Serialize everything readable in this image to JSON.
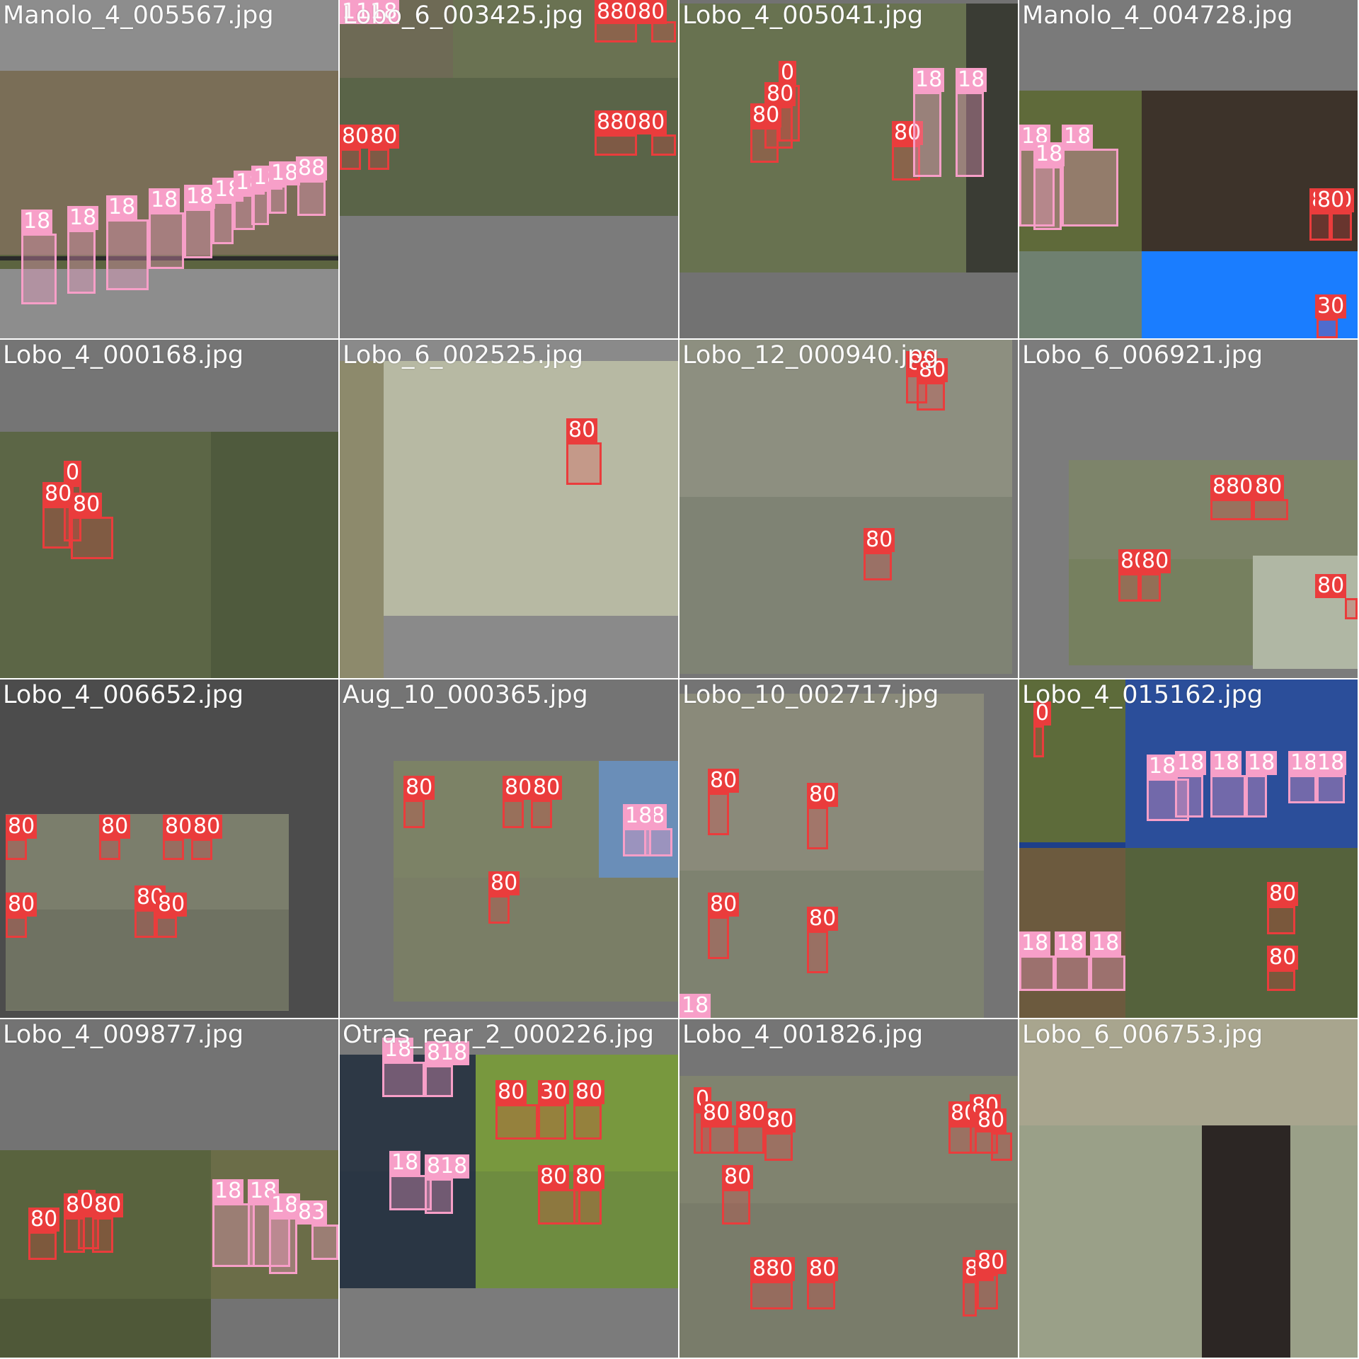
{
  "grid": {
    "tiles": [
      {
        "title": "Manolo_4_005567.jpg",
        "bg": "#8d8d8d",
        "scene": [
          {
            "color": "#7a6e57"
          },
          {
            "color": "#5c6440"
          },
          {
            "color": "#2a2a2a"
          }
        ],
        "detections": [
          {
            "label": "18",
            "class": "sheep"
          },
          {
            "label": "18",
            "class": "sheep"
          },
          {
            "label": "18",
            "class": "sheep"
          },
          {
            "label": "18",
            "class": "sheep"
          },
          {
            "label": "18",
            "class": "sheep"
          },
          {
            "label": "18",
            "class": "sheep"
          },
          {
            "label": "18",
            "class": "sheep"
          },
          {
            "label": "18",
            "class": "sheep"
          },
          {
            "label": "18",
            "class": "sheep"
          },
          {
            "label": "88",
            "class": "sheep"
          }
        ]
      },
      {
        "title": "Lobo_6_003425.jpg",
        "bg": "#7b7b7b",
        "scene": [
          {
            "color": "#6e6a55"
          },
          {
            "color": "#5a6448"
          },
          {
            "color": "#6a7252"
          },
          {
            "color": "#7a7a7a"
          }
        ],
        "detections": [
          {
            "label": "18",
            "class": "sheep"
          },
          {
            "label": "18",
            "class": "sheep"
          },
          {
            "label": "18",
            "class": "sheep"
          },
          {
            "label": "880",
            "class": "wolf"
          },
          {
            "label": "80",
            "class": "wolf"
          },
          {
            "label": "80",
            "class": "wolf"
          },
          {
            "label": "80",
            "class": "wolf"
          },
          {
            "label": "880",
            "class": "wolf"
          },
          {
            "label": "80",
            "class": "wolf"
          }
        ]
      },
      {
        "title": "Lobo_4_005041.jpg",
        "bg": "#727272",
        "scene": [
          {
            "color": "#687250"
          },
          {
            "color": "#3a3c34"
          }
        ],
        "detections": [
          {
            "label": "0",
            "class": "wolf"
          },
          {
            "label": "80",
            "class": "wolf"
          },
          {
            "label": "80",
            "class": "wolf"
          },
          {
            "label": "80",
            "class": "wolf"
          },
          {
            "label": "18",
            "class": "sheep"
          },
          {
            "label": "18",
            "class": "sheep"
          }
        ]
      },
      {
        "title": "Manolo_4_004728.jpg",
        "bg": "#7a7a7a",
        "scene": [
          {
            "color": "#5f6a3a"
          },
          {
            "color": "#3d332a"
          },
          {
            "color": "#6f8070"
          },
          {
            "color": "#1a7dff"
          },
          {
            "color": "#55664a"
          }
        ],
        "detections": [
          {
            "label": "18",
            "class": "sheep"
          },
          {
            "label": "18",
            "class": "sheep"
          },
          {
            "label": "18",
            "class": "sheep"
          },
          {
            "label": "800",
            "class": "wolf"
          },
          {
            "label": "80",
            "class": "wolf"
          },
          {
            "label": "30",
            "class": "wolf"
          }
        ]
      },
      {
        "title": "Lobo_4_000168.jpg",
        "bg": "#757575",
        "scene": [
          {
            "color": "#5c6646"
          },
          {
            "color": "#4f5a3d"
          }
        ],
        "detections": [
          {
            "label": "0",
            "class": "wolf"
          },
          {
            "label": "80",
            "class": "wolf"
          },
          {
            "label": "80",
            "class": "wolf"
          }
        ]
      },
      {
        "title": "Lobo_6_002525.jpg",
        "bg": "#8a8a8a",
        "scene": [
          {
            "color": "#8d8a6c"
          },
          {
            "color": "#b7b9a3"
          }
        ],
        "detections": [
          {
            "label": "80",
            "class": "wolf"
          }
        ]
      },
      {
        "title": "Lobo_12_000940.jpg",
        "bg": "#767676",
        "scene": [
          {
            "color": "#8d8f80"
          },
          {
            "color": "#7f8374"
          }
        ],
        "detections": [
          {
            "label": "80",
            "class": "wolf"
          },
          {
            "label": "80",
            "class": "wolf"
          },
          {
            "label": "80",
            "class": "wolf"
          }
        ]
      },
      {
        "title": "Lobo_6_006921.jpg",
        "bg": "#7c7c7c",
        "scene": [
          {
            "color": "#7d846a"
          },
          {
            "color": "#76805f"
          },
          {
            "color": "#b0b7a4"
          }
        ],
        "detections": [
          {
            "label": "880",
            "class": "wolf"
          },
          {
            "label": "80",
            "class": "wolf"
          },
          {
            "label": "80",
            "class": "wolf"
          },
          {
            "label": "80",
            "class": "wolf"
          },
          {
            "label": "80",
            "class": "wolf"
          }
        ]
      },
      {
        "title": "Lobo_4_006652.jpg",
        "bg": "#4c4c4c",
        "scene": [
          {
            "color": "#7b7e6c"
          },
          {
            "color": "#6f7262"
          }
        ],
        "detections": [
          {
            "label": "80",
            "class": "wolf"
          },
          {
            "label": "80",
            "class": "wolf"
          },
          {
            "label": "80",
            "class": "wolf"
          },
          {
            "label": "80",
            "class": "wolf"
          },
          {
            "label": "80",
            "class": "wolf"
          },
          {
            "label": "80",
            "class": "wolf"
          },
          {
            "label": "80",
            "class": "wolf"
          }
        ]
      },
      {
        "title": "Aug_10_000365.jpg",
        "bg": "#747474",
        "scene": [
          {
            "color": "#7c8266"
          },
          {
            "color": "#6a8eb8"
          },
          {
            "color": "#7a7e66"
          }
        ],
        "detections": [
          {
            "label": "80",
            "class": "wolf"
          },
          {
            "label": "80",
            "class": "wolf"
          },
          {
            "label": "80",
            "class": "wolf"
          },
          {
            "label": "18",
            "class": "sheep"
          },
          {
            "label": "18",
            "class": "sheep"
          },
          {
            "label": "80",
            "class": "wolf"
          }
        ]
      },
      {
        "title": "Lobo_10_002717.jpg",
        "bg": "#747474",
        "scene": [
          {
            "color": "#8a8a7a"
          },
          {
            "color": "#7e8270"
          }
        ],
        "detections": [
          {
            "label": "80",
            "class": "wolf"
          },
          {
            "label": "80",
            "class": "wolf"
          },
          {
            "label": "80",
            "class": "wolf"
          },
          {
            "label": "80",
            "class": "wolf"
          },
          {
            "label": "18",
            "class": "sheep"
          }
        ]
      },
      {
        "title": "Lobo_4_015162.jpg",
        "bg": "#1d3f8a",
        "scene": [
          {
            "color": "#5d6b3a"
          },
          {
            "color": "#2b4e9a"
          },
          {
            "color": "#6c5a3e"
          },
          {
            "color": "#55623c"
          }
        ],
        "detections": [
          {
            "label": "0",
            "class": "wolf"
          },
          {
            "label": "18",
            "class": "sheep"
          },
          {
            "label": "18",
            "class": "sheep"
          },
          {
            "label": "18",
            "class": "sheep"
          },
          {
            "label": "18",
            "class": "sheep"
          },
          {
            "label": "18",
            "class": "sheep"
          },
          {
            "label": "18",
            "class": "sheep"
          },
          {
            "label": "80",
            "class": "wolf"
          },
          {
            "label": "18",
            "class": "sheep"
          },
          {
            "label": "18",
            "class": "sheep"
          },
          {
            "label": "18",
            "class": "sheep"
          },
          {
            "label": "80",
            "class": "wolf"
          }
        ]
      },
      {
        "title": "Lobo_4_009877.jpg",
        "bg": "#737373",
        "scene": [
          {
            "color": "#59633e"
          },
          {
            "color": "#6b6d48"
          },
          {
            "color": "#4f5838"
          }
        ],
        "detections": [
          {
            "label": "80",
            "class": "wolf"
          },
          {
            "label": "80",
            "class": "wolf"
          },
          {
            "label": "0",
            "class": "wolf"
          },
          {
            "label": "80",
            "class": "wolf"
          },
          {
            "label": "18",
            "class": "sheep"
          },
          {
            "label": "18",
            "class": "sheep"
          },
          {
            "label": "18",
            "class": "sheep"
          },
          {
            "label": "83",
            "class": "sheep"
          }
        ]
      },
      {
        "title": "Otras_rear_2_000226.jpg",
        "bg": "#7b7b7b",
        "scene": [
          {
            "color": "#2d3845"
          },
          {
            "color": "#78983e"
          },
          {
            "color": "#2a3644"
          },
          {
            "color": "#6e8c40"
          }
        ],
        "detections": [
          {
            "label": "18",
            "class": "sheep"
          },
          {
            "label": "818",
            "class": "sheep"
          },
          {
            "label": "80",
            "class": "wolf"
          },
          {
            "label": "30",
            "class": "wolf"
          },
          {
            "label": "80",
            "class": "wolf"
          },
          {
            "label": "18",
            "class": "sheep"
          },
          {
            "label": "818",
            "class": "sheep"
          },
          {
            "label": "80",
            "class": "wolf"
          },
          {
            "label": "80",
            "class": "wolf"
          }
        ]
      },
      {
        "title": "Lobo_4_001826.jpg",
        "bg": "#757575",
        "scene": [
          {
            "color": "#80836f"
          },
          {
            "color": "#797c6a"
          }
        ],
        "detections": [
          {
            "label": "0",
            "class": "wolf"
          },
          {
            "label": "80",
            "class": "wolf"
          },
          {
            "label": "80",
            "class": "wolf"
          },
          {
            "label": "80",
            "class": "wolf"
          },
          {
            "label": "80",
            "class": "wolf"
          },
          {
            "label": "80",
            "class": "wolf"
          },
          {
            "label": "80",
            "class": "wolf"
          },
          {
            "label": "80",
            "class": "wolf"
          },
          {
            "label": "880",
            "class": "wolf"
          },
          {
            "label": "80",
            "class": "wolf"
          },
          {
            "label": "80",
            "class": "wolf"
          },
          {
            "label": "80",
            "class": "wolf"
          }
        ]
      },
      {
        "title": "Lobo_6_006753.jpg",
        "bg": "#b0ae9a",
        "scene": [
          {
            "color": "#a8a58e"
          },
          {
            "color": "#9aa088"
          },
          {
            "color": "#2c2624"
          }
        ],
        "detections": []
      }
    ],
    "class_colors": {
      "wolf": "#ea3c3c",
      "sheep": "#f79fc8"
    }
  }
}
